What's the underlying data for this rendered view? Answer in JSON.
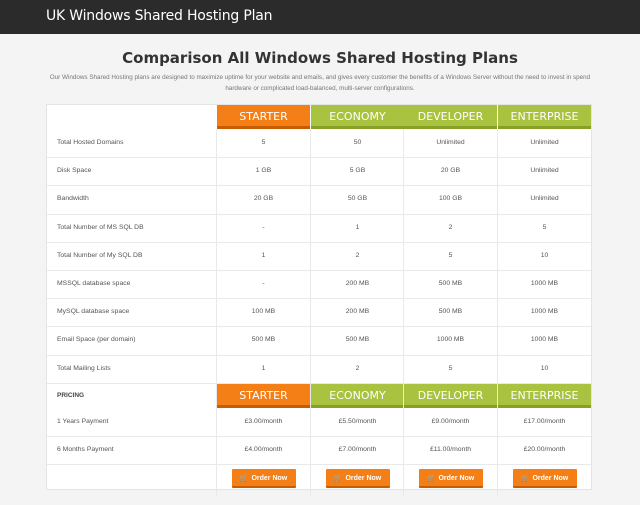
{
  "topbar": {
    "title": "UK Windows Shared Hosting Plan"
  },
  "heading": "Comparison All Windows Shared Hosting Plans",
  "intro": "Our Windows Shared Hosting plans are designed to maximize uptime for your website and emails, and gives every customer the benefits of a Windows Server without the need to invest in spend hardware or complicated load-balanced, multi-server configurations.",
  "plans": [
    "STARTER",
    "ECONOMY",
    "DEVELOPER",
    "ENTERPRISE"
  ],
  "features": [
    {
      "label": "Total Hosted Domains",
      "values": [
        "5",
        "50",
        "Unlimited",
        "Unlimited"
      ]
    },
    {
      "label": "Disk Space",
      "values": [
        "1 GB",
        "5 GB",
        "20 GB",
        "Unlimited"
      ]
    },
    {
      "label": "Bandwidth",
      "values": [
        "20 GB",
        "50 GB",
        "100 GB",
        "Unlimited"
      ]
    },
    {
      "label": "Total Number of MS SQL DB",
      "values": [
        "-",
        "1",
        "2",
        "5"
      ]
    },
    {
      "label": "Total Number of My SQL DB",
      "values": [
        "1",
        "2",
        "5",
        "10"
      ]
    },
    {
      "label": "MSSQL database space",
      "values": [
        "-",
        "200 MB",
        "500 MB",
        "1000 MB"
      ]
    },
    {
      "label": "MySQL database space",
      "values": [
        "100 MB",
        "200 MB",
        "500 MB",
        "1000 MB"
      ]
    },
    {
      "label": "Email Space (per domain)",
      "values": [
        "500 MB",
        "500 MB",
        "1000 MB",
        "1000 MB"
      ]
    },
    {
      "label": "Total Mailing Lists",
      "values": [
        "1",
        "2",
        "5",
        "10"
      ]
    }
  ],
  "pricing_label": "PRICING",
  "pricing": [
    {
      "label": "1 Years Payment",
      "values": [
        "£3.00/month",
        "£5.50/month",
        "£9.00/month",
        "£17.00/month"
      ]
    },
    {
      "label": "6 Months Payment",
      "values": [
        "£4.00/month",
        "£7.00/month",
        "£11.00/month",
        "£20.00/month"
      ]
    }
  ],
  "order_button_label": "Order Now",
  "icons": {
    "cart": "shopping-cart-icon"
  },
  "colors": {
    "starter": "#f57f17",
    "plan": "#a9c23f",
    "topbar": "#2b2b2b"
  }
}
